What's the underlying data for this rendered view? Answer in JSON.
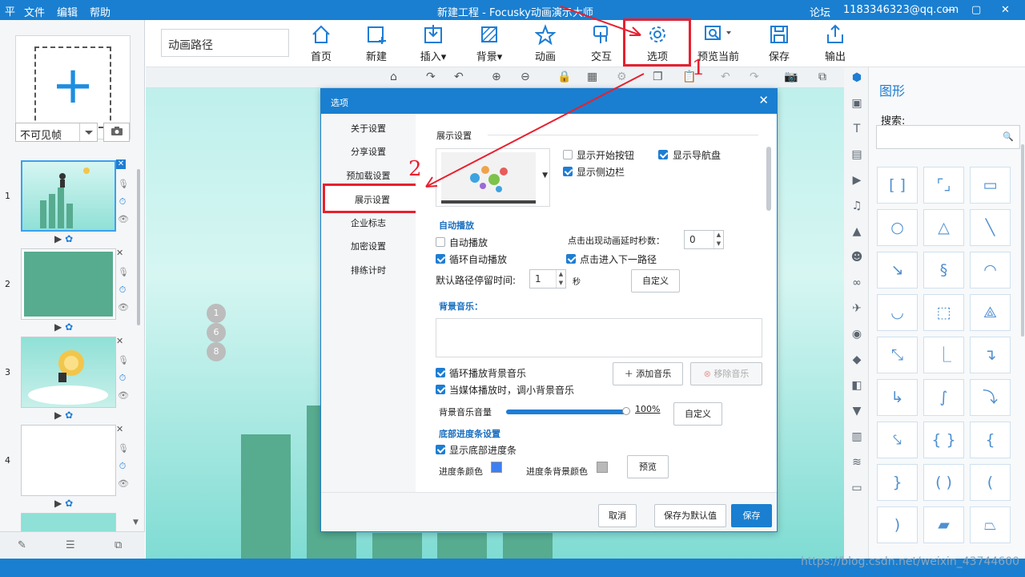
{
  "app": {
    "logo": "平",
    "menu": [
      "文件",
      "编辑",
      "帮助"
    ],
    "title": "新建工程 - Focusky动画演示大师",
    "forum": "论坛",
    "user": "1183346323@qq.com",
    "window_controls": [
      "—",
      "▢",
      "✕"
    ]
  },
  "left": {
    "frame_select": "不可见帧",
    "slides": [
      {
        "num": "1",
        "selected": true
      },
      {
        "num": "2",
        "selected": false
      },
      {
        "num": "3",
        "selected": false
      },
      {
        "num": "4",
        "selected": false
      }
    ]
  },
  "toolbar": {
    "path_name": "动画路径",
    "buttons": [
      {
        "label": "首页",
        "icon": "home-icon"
      },
      {
        "label": "新建",
        "icon": "new-frame-icon"
      },
      {
        "label": "插入",
        "icon": "insert-icon"
      },
      {
        "label": "背景",
        "icon": "background-icon"
      },
      {
        "label": "动画",
        "icon": "animation-icon"
      },
      {
        "label": "交互",
        "icon": "interaction-icon"
      },
      {
        "label": "选项",
        "icon": "gear-icon"
      },
      {
        "label": "预览当前",
        "icon": "preview-icon"
      },
      {
        "label": "保存",
        "icon": "save-icon"
      },
      {
        "label": "输出",
        "icon": "export-icon"
      }
    ]
  },
  "canvas": {
    "path_markers": [
      "1",
      "6",
      "8"
    ]
  },
  "right": {
    "title": "图形",
    "search_label": "搜索:",
    "search_placeholder": ""
  },
  "dialog": {
    "title": "选项",
    "nav": [
      "关于设置",
      "分享设置",
      "预加载设置",
      "展示设置",
      "企业标志",
      "加密设置",
      "排练计时"
    ],
    "active_nav": "展示设置",
    "display_section": "展示设置",
    "show_start_button": {
      "label": "显示开始按钮",
      "checked": false
    },
    "show_nav_disc": {
      "label": "显示导航盘",
      "checked": true
    },
    "show_sidebar": {
      "label": "显示侧边栏",
      "checked": true
    },
    "autoplay_section": "自动播放",
    "autoplay": {
      "label": "自动播放",
      "checked": false
    },
    "loop_autoplay": {
      "label": "循环自动播放",
      "checked": true
    },
    "click_delay_label": "点击出现动画延时秒数：",
    "click_delay_value": "0",
    "click_next": {
      "label": "点击进入下一路径",
      "checked": true
    },
    "stay_time_label": "默认路径停留时间:",
    "stay_time_value": "1",
    "stay_time_unit": "秒",
    "custom_label": "自定义",
    "music_section": "背景音乐：",
    "loop_music": {
      "label": "循环播放背景音乐",
      "checked": true
    },
    "duck_music": {
      "label": "当媒体播放时，调小背景音乐",
      "checked": true
    },
    "add_music": "添加音乐",
    "remove_music": "移除音乐",
    "volume_label": "背景音乐音量",
    "volume_value": "100%",
    "volume_fraction": 1.0,
    "custom2_label": "自定义",
    "progress_section": "底部进度条设置",
    "show_progress": {
      "label": "显示底部进度条",
      "checked": true
    },
    "progress_color_label": "进度条颜色",
    "progress_color": "#3d7ff2",
    "progress_bg_label": "进度条背景颜色",
    "progress_bg_color": "#b9b9b9",
    "preview_label": "预览",
    "cancel": "取消",
    "save_default": "保存为默认值",
    "save": "保存"
  },
  "annotations": {
    "step1": "1",
    "step2": "2"
  },
  "watermark": "https://blog.csdn.net/weixin_43744600",
  "colors": {
    "accent": "#1a7fd0",
    "annotation": "#e8202f",
    "chart_bar": "#57ab8f"
  }
}
